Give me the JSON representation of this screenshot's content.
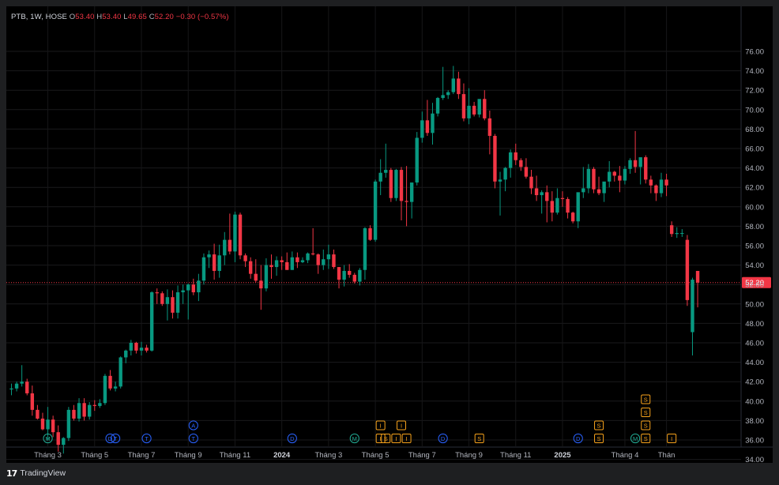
{
  "legend": {
    "symbol": "PTB, 1W, HOSE",
    "o_label": "O",
    "o_value": "53.40",
    "h_label": "H",
    "h_value": "53.40",
    "l_label": "L",
    "l_value": "49.65",
    "c_label": "C",
    "c_value": "52.20",
    "change": "−0.30 (−0.57%)"
  },
  "footer": {
    "logo": "17",
    "brand": "TradingView"
  },
  "colors": {
    "up": "#089981",
    "down": "#f23645",
    "grid": "#1c1c1e",
    "axis_text": "#b2b5be",
    "background": "#000000",
    "dividend": "#2962ff",
    "split": "#f7a21b",
    "earnings": "#22ab94"
  },
  "chart_data": {
    "type": "candlestick",
    "interval": "1W",
    "ylim": [
      33.2,
      76.6
    ],
    "y_ticks": [
      34,
      36,
      38,
      40,
      42,
      44,
      46,
      48,
      50,
      52,
      54,
      56,
      58,
      60,
      62,
      64,
      66,
      68,
      70,
      72,
      74,
      76
    ],
    "last_price": 52.2,
    "last_price_label": "52.20",
    "x_labels": [
      {
        "i": 7,
        "text": "Tháng 3",
        "bold": false
      },
      {
        "i": 16,
        "text": "Tháng 5",
        "bold": false
      },
      {
        "i": 25,
        "text": "Tháng 7",
        "bold": false
      },
      {
        "i": 34,
        "text": "Tháng 9",
        "bold": false
      },
      {
        "i": 43,
        "text": "Tháng 11",
        "bold": false
      },
      {
        "i": 52,
        "text": "2024",
        "bold": true
      },
      {
        "i": 61,
        "text": "Tháng 3",
        "bold": false
      },
      {
        "i": 70,
        "text": "Tháng 5",
        "bold": false
      },
      {
        "i": 79,
        "text": "Tháng 7",
        "bold": false
      },
      {
        "i": 88,
        "text": "Tháng 9",
        "bold": false
      },
      {
        "i": 97,
        "text": "Tháng 11",
        "bold": false
      },
      {
        "i": 106,
        "text": "2025",
        "bold": true
      },
      {
        "i": 118,
        "text": "Tháng 4",
        "bold": false
      },
      {
        "i": 126,
        "text": "Thán",
        "bold": false
      }
    ],
    "candles": [
      [
        41.2,
        41.8,
        40.6,
        41.3
      ],
      [
        41.3,
        42.0,
        41.0,
        41.8
      ],
      [
        41.8,
        43.7,
        41.5,
        42.0
      ],
      [
        42.0,
        42.3,
        40.6,
        40.8
      ],
      [
        40.8,
        41.6,
        38.5,
        39.1
      ],
      [
        39.1,
        39.6,
        38.1,
        38.2
      ],
      [
        38.2,
        38.8,
        37.0,
        37.1
      ],
      [
        37.1,
        39.4,
        36.0,
        38.1
      ],
      [
        38.1,
        38.5,
        36.3,
        36.8
      ],
      [
        36.8,
        37.5,
        34.8,
        35.5
      ],
      [
        35.5,
        36.3,
        34.6,
        36.2
      ],
      [
        36.2,
        39.4,
        35.9,
        39.1
      ],
      [
        39.1,
        39.6,
        38.0,
        38.2
      ],
      [
        38.2,
        40.3,
        37.9,
        39.8
      ],
      [
        39.8,
        40.3,
        38.0,
        38.4
      ],
      [
        38.4,
        39.9,
        38.1,
        39.6
      ],
      [
        39.6,
        40.1,
        39.0,
        39.5
      ],
      [
        39.5,
        40.2,
        39.3,
        39.8
      ],
      [
        39.8,
        42.8,
        39.6,
        42.6
      ],
      [
        42.6,
        43.2,
        41.1,
        41.3
      ],
      [
        41.3,
        42.0,
        41.0,
        41.5
      ],
      [
        41.5,
        44.6,
        41.3,
        44.5
      ],
      [
        44.5,
        45.3,
        43.9,
        45.2
      ],
      [
        45.2,
        46.3,
        44.7,
        46.0
      ],
      [
        46.0,
        46.1,
        44.9,
        45.2
      ],
      [
        45.2,
        46.1,
        44.7,
        45.5
      ],
      [
        45.5,
        45.8,
        45.0,
        45.2
      ],
      [
        45.2,
        51.3,
        45.1,
        51.2
      ],
      [
        51.2,
        51.6,
        50.0,
        51.1
      ],
      [
        51.1,
        51.3,
        49.8,
        50.0
      ],
      [
        50.0,
        51.5,
        48.3,
        50.7
      ],
      [
        50.7,
        51.4,
        48.5,
        49.1
      ],
      [
        49.1,
        51.9,
        48.5,
        51.2
      ],
      [
        51.2,
        52.0,
        50.0,
        51.4
      ],
      [
        51.4,
        52.1,
        48.4,
        52.0
      ],
      [
        52.0,
        52.6,
        50.9,
        51.2
      ],
      [
        51.2,
        53.1,
        50.3,
        52.4
      ],
      [
        52.4,
        55.2,
        52.0,
        54.8
      ],
      [
        54.8,
        55.5,
        53.7,
        55.1
      ],
      [
        55.1,
        56.2,
        52.5,
        53.4
      ],
      [
        53.4,
        56.1,
        52.7,
        55.0
      ],
      [
        55.0,
        57.4,
        54.0,
        56.6
      ],
      [
        56.6,
        59.3,
        55.1,
        55.4
      ],
      [
        55.4,
        59.5,
        54.3,
        59.2
      ],
      [
        59.2,
        59.4,
        54.6,
        55.0
      ],
      [
        55.0,
        55.2,
        53.8,
        54.4
      ],
      [
        54.4,
        54.8,
        52.6,
        53.1
      ],
      [
        53.1,
        54.6,
        52.2,
        52.4
      ],
      [
        52.4,
        54.0,
        49.4,
        51.6
      ],
      [
        51.6,
        54.7,
        51.3,
        54.0
      ],
      [
        54.0,
        55.1,
        52.6,
        53.8
      ],
      [
        53.8,
        54.9,
        52.9,
        54.5
      ],
      [
        54.5,
        54.9,
        53.5,
        54.3
      ],
      [
        54.3,
        55.3,
        53.5,
        53.5
      ],
      [
        53.5,
        55.4,
        53.5,
        54.8
      ],
      [
        54.8,
        55.3,
        53.7,
        54.3
      ],
      [
        54.3,
        54.8,
        54.2,
        54.5
      ],
      [
        54.5,
        55.3,
        54.2,
        55.2
      ],
      [
        55.2,
        57.8,
        55.0,
        55.1
      ],
      [
        55.1,
        55.2,
        53.1,
        54.0
      ],
      [
        54.0,
        55.6,
        53.5,
        54.6
      ],
      [
        54.6,
        56.1,
        53.6,
        55.1
      ],
      [
        55.1,
        55.6,
        53.6,
        53.8
      ],
      [
        53.8,
        53.8,
        51.6,
        52.5
      ],
      [
        52.5,
        54.0,
        51.8,
        53.4
      ],
      [
        53.4,
        54.1,
        52.7,
        53.0
      ],
      [
        53.0,
        53.2,
        52.1,
        52.3
      ],
      [
        52.3,
        53.7,
        51.9,
        53.5
      ],
      [
        53.5,
        57.9,
        52.5,
        57.8
      ],
      [
        57.8,
        58.1,
        56.5,
        56.6
      ],
      [
        56.6,
        62.8,
        56.4,
        62.6
      ],
      [
        62.6,
        64.9,
        61.2,
        63.5
      ],
      [
        63.5,
        66.5,
        63.0,
        63.8
      ],
      [
        63.8,
        64.0,
        60.5,
        60.9
      ],
      [
        60.9,
        63.9,
        60.6,
        63.8
      ],
      [
        63.8,
        64.1,
        58.6,
        60.6
      ],
      [
        60.6,
        64.2,
        58.0,
        60.5
      ],
      [
        60.5,
        62.4,
        58.8,
        62.5
      ],
      [
        62.5,
        67.7,
        62.2,
        67.1
      ],
      [
        67.1,
        69.8,
        66.6,
        68.9
      ],
      [
        68.9,
        71.0,
        67.3,
        67.6
      ],
      [
        67.6,
        70.7,
        66.4,
        69.6
      ],
      [
        69.6,
        71.3,
        69.3,
        71.2
      ],
      [
        71.2,
        74.4,
        71.0,
        71.5
      ],
      [
        71.5,
        72.0,
        71.1,
        71.8
      ],
      [
        71.8,
        74.5,
        71.6,
        73.2
      ],
      [
        73.2,
        73.9,
        71.1,
        71.6
      ],
      [
        71.6,
        72.7,
        68.8,
        69.1
      ],
      [
        69.1,
        72.2,
        68.5,
        70.4
      ],
      [
        70.4,
        70.8,
        69.3,
        69.5
      ],
      [
        69.5,
        70.9,
        69.2,
        71.1
      ],
      [
        71.1,
        72.0,
        68.9,
        69.1
      ],
      [
        69.1,
        69.9,
        65.4,
        67.3
      ],
      [
        67.3,
        67.5,
        61.9,
        62.6
      ],
      [
        62.6,
        63.6,
        59.1,
        62.8
      ],
      [
        62.8,
        64.1,
        61.6,
        64.0
      ],
      [
        64.0,
        65.9,
        63.0,
        65.6
      ],
      [
        65.6,
        66.5,
        64.3,
        64.8
      ],
      [
        64.8,
        65.0,
        63.7,
        64.1
      ],
      [
        64.1,
        65.0,
        62.9,
        63.1
      ],
      [
        63.1,
        63.8,
        61.3,
        61.9
      ],
      [
        61.9,
        63.2,
        60.6,
        61.2
      ],
      [
        61.2,
        61.7,
        59.3,
        61.5
      ],
      [
        61.5,
        62.2,
        58.4,
        60.6
      ],
      [
        60.6,
        61.6,
        58.5,
        59.4
      ],
      [
        59.4,
        61.9,
        59.2,
        60.9
      ],
      [
        60.9,
        61.6,
        60.0,
        60.8
      ],
      [
        60.8,
        61.0,
        58.8,
        59.4
      ],
      [
        59.4,
        59.5,
        58.3,
        58.5
      ],
      [
        58.5,
        60.8,
        57.8,
        61.5
      ],
      [
        61.5,
        64.1,
        60.9,
        61.9
      ],
      [
        61.9,
        64.4,
        61.4,
        63.9
      ],
      [
        63.9,
        64.1,
        61.4,
        61.8
      ],
      [
        61.8,
        63.1,
        61.2,
        61.4
      ],
      [
        61.4,
        62.5,
        60.5,
        62.6
      ],
      [
        62.6,
        64.7,
        62.0,
        63.6
      ],
      [
        63.6,
        63.7,
        62.6,
        63.2
      ],
      [
        63.2,
        64.2,
        61.5,
        62.7
      ],
      [
        62.7,
        64.2,
        62.3,
        63.9
      ],
      [
        63.9,
        65.0,
        63.4,
        64.8
      ],
      [
        64.8,
        67.8,
        63.5,
        64.1
      ],
      [
        64.1,
        64.8,
        62.3,
        65.1
      ],
      [
        65.1,
        65.3,
        62.4,
        62.8
      ],
      [
        62.8,
        63.2,
        61.4,
        62.2
      ],
      [
        62.2,
        62.3,
        60.6,
        61.4
      ],
      [
        61.4,
        63.5,
        61.0,
        62.8
      ],
      [
        62.8,
        63.4,
        61.1,
        62.2
      ]
    ],
    "events": [
      {
        "i": 7,
        "row": 0,
        "label": "M",
        "kind": "earnings"
      },
      {
        "i": 19,
        "row": 0,
        "label": "D",
        "kind": "dividend"
      },
      {
        "i": 20,
        "row": 0,
        "label": "T",
        "kind": "dividend"
      },
      {
        "i": 26,
        "row": 0,
        "label": "T",
        "kind": "dividend"
      },
      {
        "i": 35,
        "row": 0,
        "label": "T",
        "kind": "dividend"
      },
      {
        "i": 35,
        "row": 1,
        "label": "A",
        "kind": "dividend"
      },
      {
        "i": 54,
        "row": 0,
        "label": "D",
        "kind": "dividend"
      },
      {
        "i": 66,
        "row": 0,
        "label": "M",
        "kind": "earnings"
      },
      {
        "i": 71,
        "row": 0,
        "label": "I",
        "kind": "split"
      },
      {
        "i": 72,
        "row": 0,
        "label": "S",
        "kind": "split"
      },
      {
        "i": 74,
        "row": 0,
        "label": "I",
        "kind": "split"
      },
      {
        "i": 76,
        "row": 0,
        "label": "I",
        "kind": "split"
      },
      {
        "i": 71,
        "row": 1,
        "label": "I",
        "kind": "split"
      },
      {
        "i": 75,
        "row": 1,
        "label": "I",
        "kind": "split"
      },
      {
        "i": 83,
        "row": 0,
        "label": "D",
        "kind": "dividend"
      },
      {
        "i": 90,
        "row": 0,
        "label": "S",
        "kind": "split"
      },
      {
        "i": 109,
        "row": 0,
        "label": "D",
        "kind": "dividend"
      },
      {
        "i": 113,
        "row": 0,
        "label": "S",
        "kind": "split"
      },
      {
        "i": 113,
        "row": 1,
        "label": "S",
        "kind": "split"
      },
      {
        "i": 120,
        "row": 0,
        "label": "M",
        "kind": "earnings"
      },
      {
        "i": 122,
        "row": 0,
        "label": "S",
        "kind": "split"
      },
      {
        "i": 122,
        "row": 1,
        "label": "S",
        "kind": "split"
      },
      {
        "i": 122,
        "row": 2,
        "label": "S",
        "kind": "split"
      },
      {
        "i": 122,
        "row": 3,
        "label": "S",
        "kind": "split"
      },
      {
        "i": 127,
        "row": 0,
        "label": "I",
        "kind": "split"
      }
    ],
    "late_candles": [
      [
        58.1,
        58.5,
        56.9,
        57.2
      ],
      [
        57.2,
        57.9,
        56.8,
        57.3
      ],
      [
        57.3,
        57.7,
        56.9,
        57.3
      ],
      [
        56.6,
        57.1,
        49.8,
        50.4
      ],
      [
        47.1,
        52.7,
        44.7,
        52.5
      ],
      [
        53.4,
        53.4,
        49.65,
        52.2
      ]
    ]
  }
}
